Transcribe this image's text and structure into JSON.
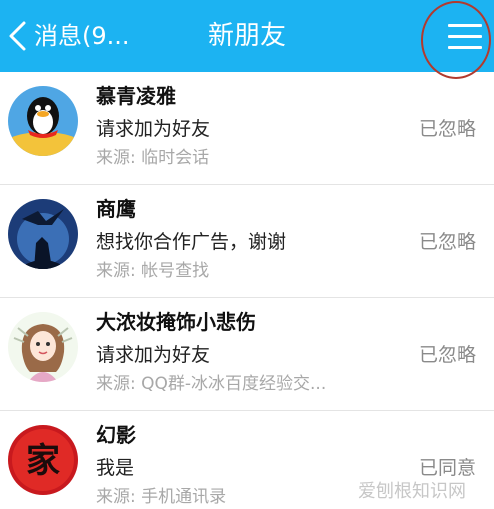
{
  "header": {
    "back_label": "消息(9...",
    "title": "新朋友",
    "back_icon": "chevron-left-icon",
    "menu_icon": "hamburger-menu-icon",
    "accent_color": "#1cb3f2",
    "annotation_color": "#b23a2e"
  },
  "requests": [
    {
      "name": "慕青凌雅",
      "message": "请求加为好友",
      "source": "来源: 临时会话",
      "status": "已忽略",
      "avatar": "penguin-avatar"
    },
    {
      "name": "商鹰",
      "message": "想找你合作广告，谢谢",
      "source": "来源: 帐号查找",
      "status": "已忽略",
      "avatar": "eagle-wolf-avatar"
    },
    {
      "name": "大浓妆掩饰小悲伤",
      "message": "请求加为好友",
      "source": "来源: QQ群-冰冰百度经验交...",
      "status": "已忽略",
      "avatar": "cartoon-girl-avatar"
    },
    {
      "name": "幻影",
      "message": "我是",
      "source": "来源: 手机通讯录",
      "status": "已同意",
      "avatar": "jia-seal-avatar"
    }
  ],
  "avatar_text": {
    "seal_char": "家"
  },
  "watermark": {
    "text": "爱刨根知识网"
  }
}
